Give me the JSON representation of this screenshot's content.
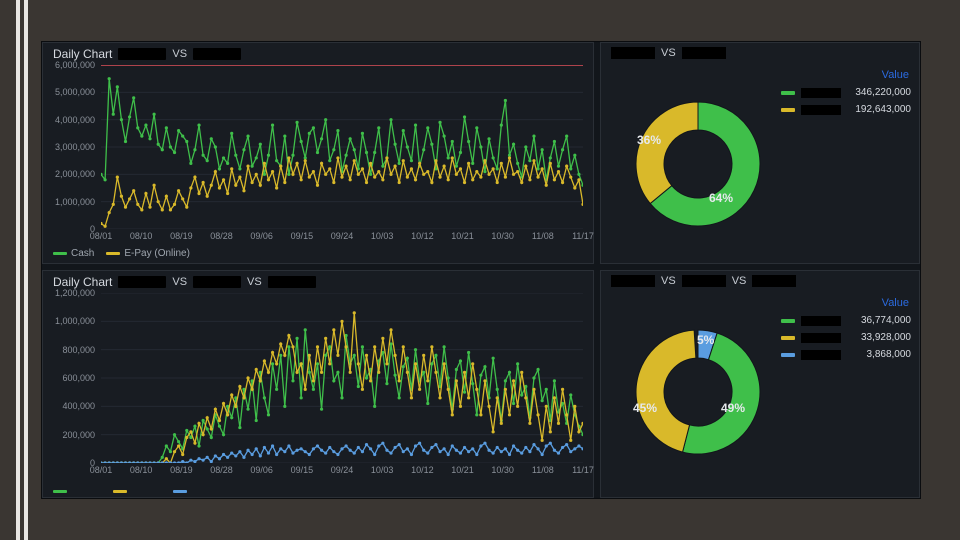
{
  "colors": {
    "green": "#3fbf4a",
    "yellow": "#d9b92a",
    "blue": "#5a9de0",
    "red": "#e0505a",
    "grid": "#2a2f36",
    "bg": "#181c22"
  },
  "chart_data": [
    {
      "id": "line_top",
      "type": "line",
      "title": "Daily Chart",
      "title_vs": "VS",
      "xlabel": "",
      "ylabel": "",
      "ylim": [
        0,
        6000000
      ],
      "categories": [
        "08/01",
        "08/10",
        "08/19",
        "08/28",
        "09/06",
        "09/15",
        "09/24",
        "10/03",
        "10/12",
        "10/21",
        "10/30",
        "11/08",
        "11/17"
      ],
      "x": [
        0,
        1,
        2,
        3,
        4,
        5,
        6,
        7,
        8,
        9,
        10,
        11,
        12,
        13,
        14,
        15,
        16,
        17,
        18,
        19,
        20,
        21,
        22,
        23,
        24,
        25,
        26,
        27,
        28,
        29,
        30,
        31,
        32,
        33,
        34,
        35,
        36,
        37,
        38,
        39,
        40,
        41,
        42,
        43,
        44,
        45,
        46,
        47,
        48,
        49,
        50,
        51,
        52,
        53,
        54,
        55,
        56,
        57,
        58,
        59,
        60,
        61,
        62,
        63,
        64,
        65,
        66,
        67,
        68,
        69,
        70,
        71,
        72,
        73,
        74,
        75,
        76,
        77,
        78,
        79,
        80,
        81,
        82,
        83,
        84,
        85,
        86,
        87,
        88,
        89,
        90,
        91,
        92,
        93,
        94,
        95,
        96,
        97,
        98,
        99,
        100,
        101,
        102,
        103,
        104,
        105,
        106,
        107,
        108,
        109,
        110,
        111,
        112,
        113,
        114,
        115,
        116,
        117,
        118
      ],
      "series": [
        {
          "name": "Cash",
          "color": "#3fbf4a",
          "values": [
            2000000,
            1800000,
            5500000,
            4200000,
            5200000,
            4000000,
            3200000,
            4100000,
            4800000,
            3700000,
            3400000,
            3800000,
            3300000,
            4200000,
            3100000,
            2900000,
            3700000,
            3000000,
            2800000,
            3600000,
            3400000,
            3200000,
            2400000,
            2900000,
            3800000,
            2700000,
            2500000,
            3300000,
            3000000,
            2200000,
            2600000,
            2400000,
            3500000,
            2700000,
            2200000,
            2900000,
            3400000,
            2300000,
            2600000,
            3100000,
            2000000,
            2700000,
            3800000,
            2500000,
            2300000,
            3400000,
            2000000,
            2700000,
            3900000,
            3200000,
            2600000,
            3500000,
            3700000,
            2800000,
            3300000,
            4000000,
            2500000,
            2900000,
            3600000,
            2100000,
            2700000,
            3300000,
            2900000,
            2200000,
            3500000,
            2800000,
            2000000,
            2800000,
            3700000,
            2300000,
            2600000,
            4000000,
            3100000,
            2400000,
            3600000,
            3000000,
            2500000,
            3800000,
            2300000,
            2900000,
            3700000,
            3100000,
            2200000,
            3900000,
            3400000,
            2600000,
            3200000,
            2300000,
            2800000,
            4100000,
            3200000,
            2400000,
            3700000,
            3000000,
            2100000,
            3300000,
            2600000,
            2200000,
            3800000,
            4700000,
            2700000,
            3100000,
            2400000,
            1900000,
            3000000,
            2500000,
            3400000,
            2200000,
            2900000,
            1800000,
            2600000,
            3200000,
            2300000,
            2900000,
            3400000,
            2200000,
            2700000,
            2000000,
            1600000
          ]
        },
        {
          "name": "E-Pay (Online)",
          "color": "#d9b92a",
          "values": [
            200000,
            100000,
            600000,
            900000,
            1900000,
            1200000,
            800000,
            1100000,
            1400000,
            900000,
            700000,
            1300000,
            800000,
            1600000,
            1000000,
            700000,
            1200000,
            700000,
            900000,
            1400000,
            1100000,
            800000,
            1500000,
            1900000,
            1300000,
            1700000,
            1200000,
            1600000,
            2100000,
            1500000,
            1800000,
            1300000,
            2200000,
            1600000,
            1900000,
            1400000,
            2300000,
            1700000,
            2000000,
            1600000,
            2400000,
            1800000,
            2100000,
            1500000,
            2300000,
            1700000,
            2600000,
            2000000,
            2400000,
            1800000,
            2500000,
            1900000,
            2100000,
            1600000,
            2400000,
            2000000,
            2200000,
            1700000,
            2600000,
            1900000,
            2300000,
            1800000,
            2500000,
            2000000,
            2200000,
            1700000,
            2400000,
            1900000,
            2100000,
            1800000,
            2600000,
            2000000,
            2300000,
            1700000,
            2500000,
            1900000,
            2200000,
            1800000,
            2400000,
            2000000,
            2100000,
            1700000,
            2500000,
            1900000,
            2300000,
            1800000,
            2600000,
            2000000,
            2200000,
            1700000,
            2400000,
            1800000,
            2100000,
            1900000,
            2500000,
            2000000,
            2200000,
            1700000,
            2400000,
            1900000,
            2600000,
            2000000,
            2100000,
            1700000,
            2300000,
            1800000,
            2500000,
            1900000,
            2200000,
            1600000,
            2400000,
            1800000,
            2100000,
            1700000,
            2300000,
            1900000,
            1500000,
            1800000,
            900000
          ]
        }
      ],
      "reference_line": {
        "y": 6000000,
        "color": "#e0505a"
      },
      "yticks": [
        0,
        1000000,
        2000000,
        3000000,
        4000000,
        5000000,
        6000000
      ]
    },
    {
      "id": "donut_top",
      "type": "pie",
      "title_vs": "VS",
      "value_header": "Value",
      "slices": [
        {
          "name_redacted": true,
          "color": "#3fbf4a",
          "value": 346220000,
          "percent": 64
        },
        {
          "name_redacted": true,
          "color": "#d9b92a",
          "value": 192643000,
          "percent": 36
        }
      ],
      "values_display": [
        "346,220,000",
        "192,643,000"
      ]
    },
    {
      "id": "line_bot",
      "type": "line",
      "title": "Daily Chart",
      "title_vs": "VS",
      "title_vs2": "VS",
      "xlabel": "",
      "ylabel": "",
      "ylim": [
        0,
        1200000
      ],
      "categories": [
        "08/01",
        "08/10",
        "08/19",
        "08/28",
        "09/06",
        "09/15",
        "09/24",
        "10/03",
        "10/12",
        "10/21",
        "10/30",
        "11/08",
        "11/17"
      ],
      "x": [
        0,
        1,
        2,
        3,
        4,
        5,
        6,
        7,
        8,
        9,
        10,
        11,
        12,
        13,
        14,
        15,
        16,
        17,
        18,
        19,
        20,
        21,
        22,
        23,
        24,
        25,
        26,
        27,
        28,
        29,
        30,
        31,
        32,
        33,
        34,
        35,
        36,
        37,
        38,
        39,
        40,
        41,
        42,
        43,
        44,
        45,
        46,
        47,
        48,
        49,
        50,
        51,
        52,
        53,
        54,
        55,
        56,
        57,
        58,
        59,
        60,
        61,
        62,
        63,
        64,
        65,
        66,
        67,
        68,
        69,
        70,
        71,
        72,
        73,
        74,
        75,
        76,
        77,
        78,
        79,
        80,
        81,
        82,
        83,
        84,
        85,
        86,
        87,
        88,
        89,
        90,
        91,
        92,
        93,
        94,
        95,
        96,
        97,
        98,
        99,
        100,
        101,
        102,
        103,
        104,
        105,
        106,
        107,
        108,
        109,
        110,
        111,
        112,
        113,
        114,
        115,
        116,
        117,
        118
      ],
      "series": [
        {
          "name_redacted": true,
          "color": "#3fbf4a",
          "values": [
            0,
            0,
            0,
            0,
            0,
            0,
            0,
            0,
            0,
            0,
            0,
            0,
            0,
            0,
            0,
            40000,
            120000,
            80000,
            200000,
            150000,
            100000,
            230000,
            180000,
            260000,
            120000,
            300000,
            240000,
            180000,
            340000,
            260000,
            200000,
            400000,
            320000,
            460000,
            250000,
            520000,
            380000,
            580000,
            300000,
            640000,
            460000,
            340000,
            700000,
            520000,
            760000,
            400000,
            820000,
            580000,
            880000,
            460000,
            940000,
            640000,
            520000,
            700000,
            380000,
            760000,
            820000,
            580000,
            640000,
            460000,
            900000,
            700000,
            760000,
            540000,
            820000,
            600000,
            660000,
            400000,
            720000,
            780000,
            560000,
            840000,
            620000,
            460000,
            680000,
            740000,
            520000,
            800000,
            580000,
            640000,
            420000,
            700000,
            760000,
            540000,
            820000,
            600000,
            380000,
            660000,
            720000,
            500000,
            780000,
            560000,
            340000,
            620000,
            680000,
            460000,
            740000,
            520000,
            300000,
            580000,
            640000,
            420000,
            700000,
            480000,
            540000,
            320000,
            600000,
            660000,
            440000,
            520000,
            300000,
            580000,
            360000,
            420000,
            280000,
            480000,
            340000,
            260000,
            200000
          ]
        },
        {
          "name_redacted": true,
          "color": "#d9b92a",
          "values": [
            0,
            0,
            0,
            0,
            0,
            0,
            0,
            0,
            0,
            0,
            0,
            0,
            0,
            0,
            0,
            0,
            30000,
            0,
            80000,
            120000,
            60000,
            180000,
            220000,
            140000,
            280000,
            200000,
            320000,
            240000,
            380000,
            300000,
            420000,
            340000,
            480000,
            400000,
            540000,
            460000,
            600000,
            520000,
            660000,
            580000,
            720000,
            640000,
            780000,
            700000,
            840000,
            760000,
            900000,
            820000,
            640000,
            700000,
            520000,
            760000,
            580000,
            820000,
            640000,
            880000,
            700000,
            940000,
            760000,
            1000000,
            820000,
            640000,
            1060000,
            700000,
            520000,
            760000,
            580000,
            820000,
            640000,
            880000,
            700000,
            940000,
            760000,
            580000,
            820000,
            640000,
            460000,
            700000,
            520000,
            760000,
            580000,
            820000,
            640000,
            460000,
            700000,
            520000,
            340000,
            580000,
            400000,
            640000,
            460000,
            700000,
            520000,
            340000,
            580000,
            400000,
            220000,
            460000,
            280000,
            520000,
            340000,
            580000,
            400000,
            640000,
            460000,
            280000,
            520000,
            340000,
            160000,
            400000,
            220000,
            460000,
            280000,
            520000,
            340000,
            160000,
            400000,
            220000,
            280000
          ]
        },
        {
          "name_redacted": true,
          "color": "#5a9de0",
          "values": [
            0,
            0,
            0,
            0,
            0,
            0,
            0,
            0,
            0,
            0,
            0,
            0,
            0,
            0,
            0,
            0,
            0,
            0,
            0,
            0,
            10000,
            0,
            20000,
            10000,
            30000,
            20000,
            40000,
            10000,
            50000,
            30000,
            60000,
            40000,
            70000,
            50000,
            80000,
            40000,
            90000,
            60000,
            100000,
            50000,
            110000,
            70000,
            120000,
            60000,
            100000,
            80000,
            120000,
            70000,
            90000,
            100000,
            80000,
            60000,
            100000,
            120000,
            90000,
            70000,
            110000,
            80000,
            60000,
            100000,
            120000,
            90000,
            70000,
            110000,
            80000,
            130000,
            100000,
            60000,
            120000,
            140000,
            90000,
            70000,
            110000,
            130000,
            80000,
            100000,
            60000,
            120000,
            140000,
            90000,
            70000,
            110000,
            130000,
            80000,
            100000,
            60000,
            120000,
            90000,
            70000,
            110000,
            80000,
            100000,
            60000,
            120000,
            140000,
            90000,
            70000,
            110000,
            80000,
            100000,
            60000,
            120000,
            90000,
            70000,
            110000,
            80000,
            130000,
            100000,
            60000,
            120000,
            140000,
            90000,
            70000,
            110000,
            130000,
            80000,
            100000,
            120000,
            100000
          ]
        }
      ],
      "yticks": [
        0,
        200000,
        400000,
        600000,
        800000,
        1000000,
        1200000
      ]
    },
    {
      "id": "donut_bot",
      "type": "pie",
      "title_vs": "VS",
      "title_vs2": "VS",
      "value_header": "Value",
      "slices": [
        {
          "name_redacted": true,
          "color": "#3fbf4a",
          "value": 36774000,
          "percent": 49
        },
        {
          "name_redacted": true,
          "color": "#d9b92a",
          "value": 33928000,
          "percent": 45
        },
        {
          "name_redacted": true,
          "color": "#5a9de0",
          "value": 3868000,
          "percent": 5
        }
      ],
      "values_display": [
        "36,774,000",
        "33,928,000",
        "3,868,000"
      ]
    }
  ],
  "yformat_top": [
    "0",
    "1,000,000",
    "2,000,000",
    "3,000,000",
    "4,000,000",
    "5,000,000",
    "6,000,000"
  ],
  "yformat_bot": [
    "0",
    "200,000",
    "400,000",
    "600,000",
    "800,000",
    "1,000,000",
    "1,200,000"
  ]
}
